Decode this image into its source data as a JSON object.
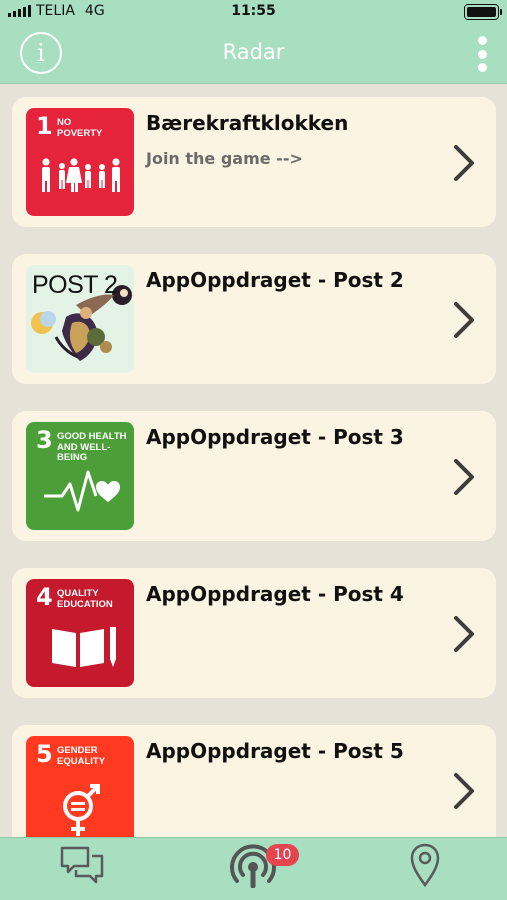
{
  "status_bar": {
    "carrier": "TELIA",
    "network": "4G",
    "time": "11:55"
  },
  "nav": {
    "title": "Radar",
    "info_icon": "info-circle-icon",
    "menu_icon": "vertical-dots-icon"
  },
  "items": [
    {
      "title": "Bærekraftklokken",
      "subtitle": "Join the game -->",
      "thumb": {
        "type": "sdg",
        "number": "1",
        "text_line1": "NO",
        "text_line2": "POVERTY",
        "color": "#e5243b",
        "icon": "family-icon"
      }
    },
    {
      "title": "AppOppdraget - Post 2",
      "subtitle": "",
      "thumb": {
        "type": "post",
        "label": "POST 2",
        "icon": "abstract-art-icon"
      }
    },
    {
      "title": "AppOppdraget - Post 3",
      "subtitle": "",
      "thumb": {
        "type": "sdg",
        "number": "3",
        "text_line1": "GOOD HEALTH",
        "text_line2": "AND WELL-BEING",
        "color": "#4c9f38",
        "icon": "heartbeat-icon"
      }
    },
    {
      "title": "AppOppdraget - Post 4",
      "subtitle": "",
      "thumb": {
        "type": "sdg",
        "number": "4",
        "text_line1": "QUALITY",
        "text_line2": "EDUCATION",
        "color": "#c5192d",
        "icon": "book-pencil-icon"
      }
    },
    {
      "title": "AppOppdraget - Post 5",
      "subtitle": "",
      "thumb": {
        "type": "sdg",
        "number": "5",
        "text_line1": "GENDER",
        "text_line2": "EQUALITY",
        "color": "#ff3a21",
        "icon": "gender-equality-icon"
      }
    }
  ],
  "tab_bar": {
    "tabs": [
      {
        "icon": "chat-bubbles-icon"
      },
      {
        "icon": "radar-icon",
        "badge": "10"
      },
      {
        "icon": "map-pin-icon"
      }
    ]
  },
  "colors": {
    "header_green": "#a8dfc0",
    "card_background": "#fcf4e2",
    "page_background": "#e7e2d8",
    "badge_red": "#e4454f"
  }
}
